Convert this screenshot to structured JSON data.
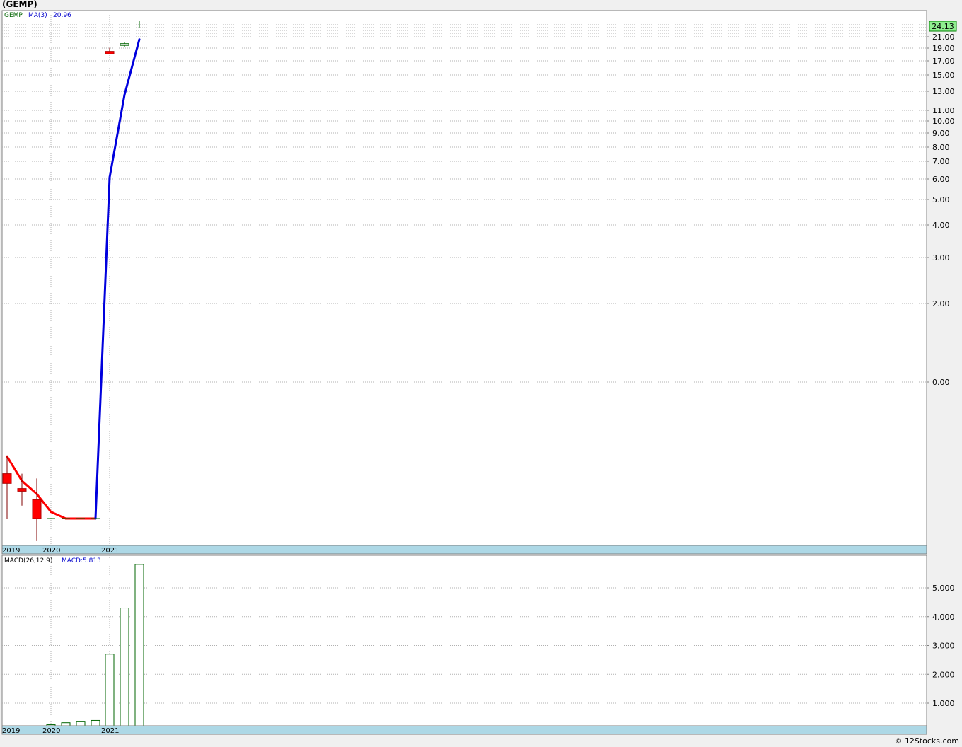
{
  "page": {
    "title": "(GEMP)",
    "credit": "© 12Stocks.com"
  },
  "price_legend": {
    "symbol": "GEMP",
    "ma_label": "MA(3)",
    "ma_value": "20.96"
  },
  "last_price_label": "24.13",
  "macd_legend": {
    "label": "MACD(26,12,9)",
    "value_label": "MACD:5.813"
  },
  "years": [
    "2019",
    "2020",
    "2021"
  ],
  "colors": {
    "up": "#006400",
    "down": "#ff0000",
    "ma_up": "#0000dd",
    "ma_down": "#ff0000",
    "axis_band": "#add8e6",
    "last_price_bg": "#90ee90",
    "macd_bar": "#006400"
  },
  "chart_data": [
    {
      "type": "candlestick",
      "title": "(GEMP)",
      "scale": "log",
      "y_tick_labels": [
        "21.00",
        "19.00",
        "17.00",
        "15.00",
        "13.00",
        "11.00",
        "10.00",
        "9.00",
        "8.00",
        "7.00",
        "6.00",
        "5.00",
        "4.00",
        "3.00",
        "2.00",
        "0.00"
      ],
      "x_tick_labels": [
        "2019",
        "2020",
        "2021"
      ],
      "grid": true,
      "candles": [
        {
          "open": 0.5,
          "high": 0.58,
          "low": 0.34,
          "close": 0.46
        },
        {
          "open": 0.44,
          "high": 0.5,
          "low": 0.38,
          "close": 0.43
        },
        {
          "open": 0.4,
          "high": 0.48,
          "low": 0.28,
          "close": 0.34
        },
        {
          "open": 0.34,
          "high": 0.34,
          "low": 0.34,
          "close": 0.34
        },
        {
          "open": 0.34,
          "high": 0.34,
          "low": 0.34,
          "close": 0.34
        },
        {
          "open": 0.34,
          "high": 0.34,
          "low": 0.34,
          "close": 0.34
        },
        {
          "open": 0.34,
          "high": 0.34,
          "low": 0.34,
          "close": 0.34
        },
        {
          "open": 18.9,
          "high": 19.5,
          "low": 18.5,
          "close": 18.5
        },
        {
          "open": 19.9,
          "high": 20.5,
          "low": 19.6,
          "close": 20.2
        },
        {
          "open": 24.13,
          "high": 24.5,
          "low": 23.2,
          "close": 24.13
        }
      ],
      "ma": {
        "name": "MA(3)",
        "values": [
          0.58,
          0.47,
          0.42,
          0.36,
          0.34,
          0.34,
          0.34,
          6.4,
          13.0,
          20.96
        ]
      },
      "last_price": 24.13
    },
    {
      "type": "bar",
      "title": "MACD(26,12,9)",
      "y_tick_labels": [
        "1.000",
        "2.000",
        "3.000",
        "4.000",
        "5.000"
      ],
      "x_tick_labels": [
        "2019",
        "2020",
        "2021"
      ],
      "values": [
        0.12,
        0.2,
        0.25,
        0.32,
        0.37,
        0.4,
        2.7,
        4.3,
        5.813
      ],
      "ylim": [
        0.25,
        6.0
      ]
    }
  ]
}
